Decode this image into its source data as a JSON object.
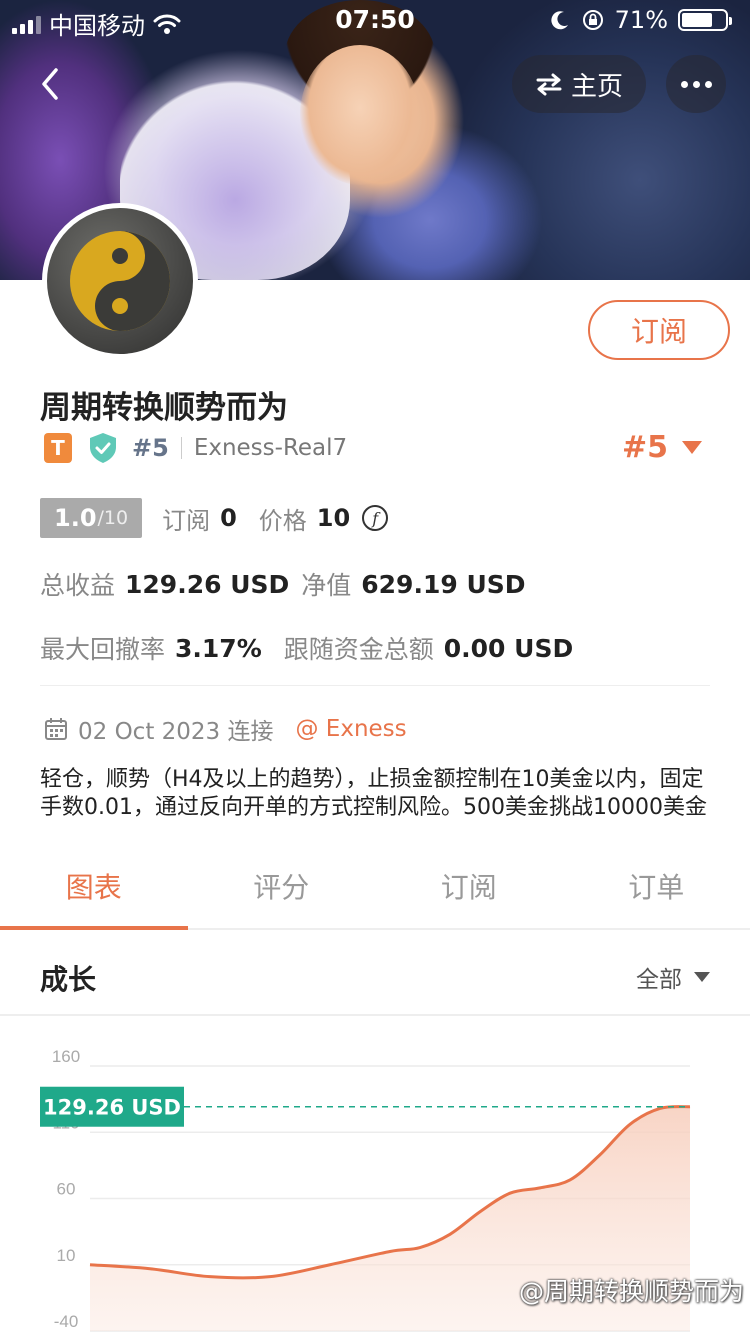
{
  "status_bar": {
    "carrier": "中国移动",
    "time": "07:50",
    "battery": "71%",
    "battery_level": 0.71
  },
  "nav": {
    "home_label": "主页"
  },
  "profile": {
    "name": "周期转换顺势而为",
    "subscribe_label": "订阅",
    "badge_t": "T",
    "rank_small": "#5",
    "account": "Exness-Real7",
    "rank_big": "#5"
  },
  "stats": {
    "score": "1.0",
    "score_max": "/10",
    "subscribe_label": "订阅",
    "subscribe_count": "0",
    "price_label": "价格",
    "price_value": "10",
    "coin_symbol": "f",
    "total_profit_label": "总收益",
    "total_profit_value": "129.26 USD",
    "equity_label": "净值",
    "equity_value": "629.19 USD",
    "max_drawdown_label": "最大回撤率",
    "max_drawdown_value": "3.17%",
    "follow_total_label": "跟随资金总额",
    "follow_total_value": "0.00 USD"
  },
  "connection": {
    "date": "02 Oct 2023 连接",
    "broker": "@ Exness"
  },
  "description": "轻仓，顺势（H4及以上的趋势），止损金额控制在10美金以内，固定手数0.01，通过反向开单的方式控制风险。500美金挑战10000美金",
  "tabs": [
    {
      "label": "图表",
      "active": true
    },
    {
      "label": "评分",
      "active": false
    },
    {
      "label": "订阅",
      "active": false
    },
    {
      "label": "订单",
      "active": false
    }
  ],
  "section": {
    "title": "成长",
    "range": "全部"
  },
  "watermark": "@周期转换顺势而为",
  "colors": {
    "accent": "#e8744a",
    "teal": "#1fa98a"
  },
  "chart_data": {
    "type": "area",
    "y_ticks": [
      "160",
      "110",
      "60",
      "10",
      "-40"
    ],
    "ylim": [
      -40,
      160
    ],
    "current_label": "129.26 USD",
    "current_value": 129.26,
    "x": [
      0,
      0.1,
      0.2,
      0.3,
      0.4,
      0.5,
      0.55,
      0.6,
      0.65,
      0.7,
      0.75,
      0.8,
      0.85,
      0.9,
      0.95,
      1.0
    ],
    "values": [
      10,
      7,
      1,
      1,
      10,
      20,
      23,
      33,
      50,
      64,
      68,
      74,
      93,
      116,
      128,
      129.26
    ],
    "grid": true
  }
}
